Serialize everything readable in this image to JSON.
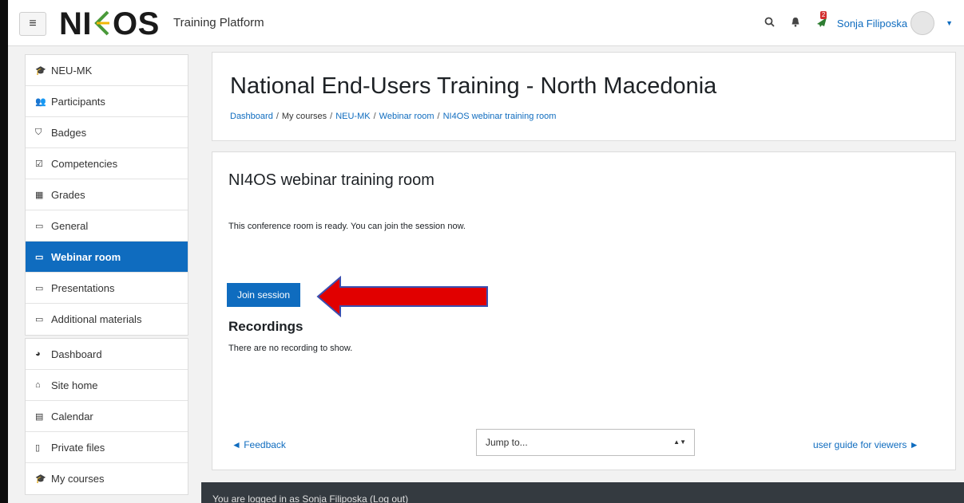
{
  "navbar": {
    "menu_icon": "hamburger-icon",
    "logo_text": "NI",
    "logo_text_end": "OS",
    "site_name": "Training Platform",
    "search_icon": "search-icon",
    "notifications_icon": "bell-icon",
    "messages_icon": "chat-icon",
    "messages_badge": "2",
    "user_name": "Sonja Filiposka",
    "user_menu_icon": "caret-down-icon"
  },
  "sidebar": {
    "course_items": [
      {
        "icon": "graduation-cap-icon",
        "label": "NEU-MK"
      },
      {
        "icon": "users-icon",
        "label": "Participants"
      },
      {
        "icon": "shield-icon",
        "label": "Badges"
      },
      {
        "icon": "checkbox-icon",
        "label": "Competencies"
      },
      {
        "icon": "table-icon",
        "label": "Grades"
      },
      {
        "icon": "folder-icon",
        "label": "General"
      },
      {
        "icon": "folder-icon",
        "label": "Webinar room"
      },
      {
        "icon": "folder-icon",
        "label": "Presentations"
      },
      {
        "icon": "folder-icon",
        "label": "Additional materials"
      }
    ],
    "site_items": [
      {
        "icon": "dashboard-icon",
        "label": "Dashboard"
      },
      {
        "icon": "home-icon",
        "label": "Site home"
      },
      {
        "icon": "calendar-icon",
        "label": "Calendar"
      },
      {
        "icon": "file-icon",
        "label": "Private files"
      },
      {
        "icon": "graduation-cap-icon",
        "label": "My courses"
      }
    ],
    "active": "Webinar room"
  },
  "header": {
    "title": "National End-Users Training - North Macedonia",
    "breadcrumb": [
      "Dashboard",
      "My courses",
      "NEU-MK",
      "Webinar room",
      "NI4OS webinar training room"
    ]
  },
  "main": {
    "room_title": "NI4OS webinar training room",
    "ready_text": "This conference room is ready. You can join the session now.",
    "join_button": "Join session",
    "recordings_title": "Recordings",
    "no_recordings_text": "There are no recording to show.",
    "feedback_link": "◄ Feedback",
    "jump_to_value": "Jump to...",
    "guide_link": "user guide for viewers ►"
  },
  "footer": {
    "logged_in_prefix": "You are logged in as ",
    "user_name": "Sonja Filiposka",
    "logout_label": "(Log out)"
  },
  "colors": {
    "accent": "#0f6cbf",
    "arrow": "#e10000",
    "footer_bg": "#343a40"
  }
}
